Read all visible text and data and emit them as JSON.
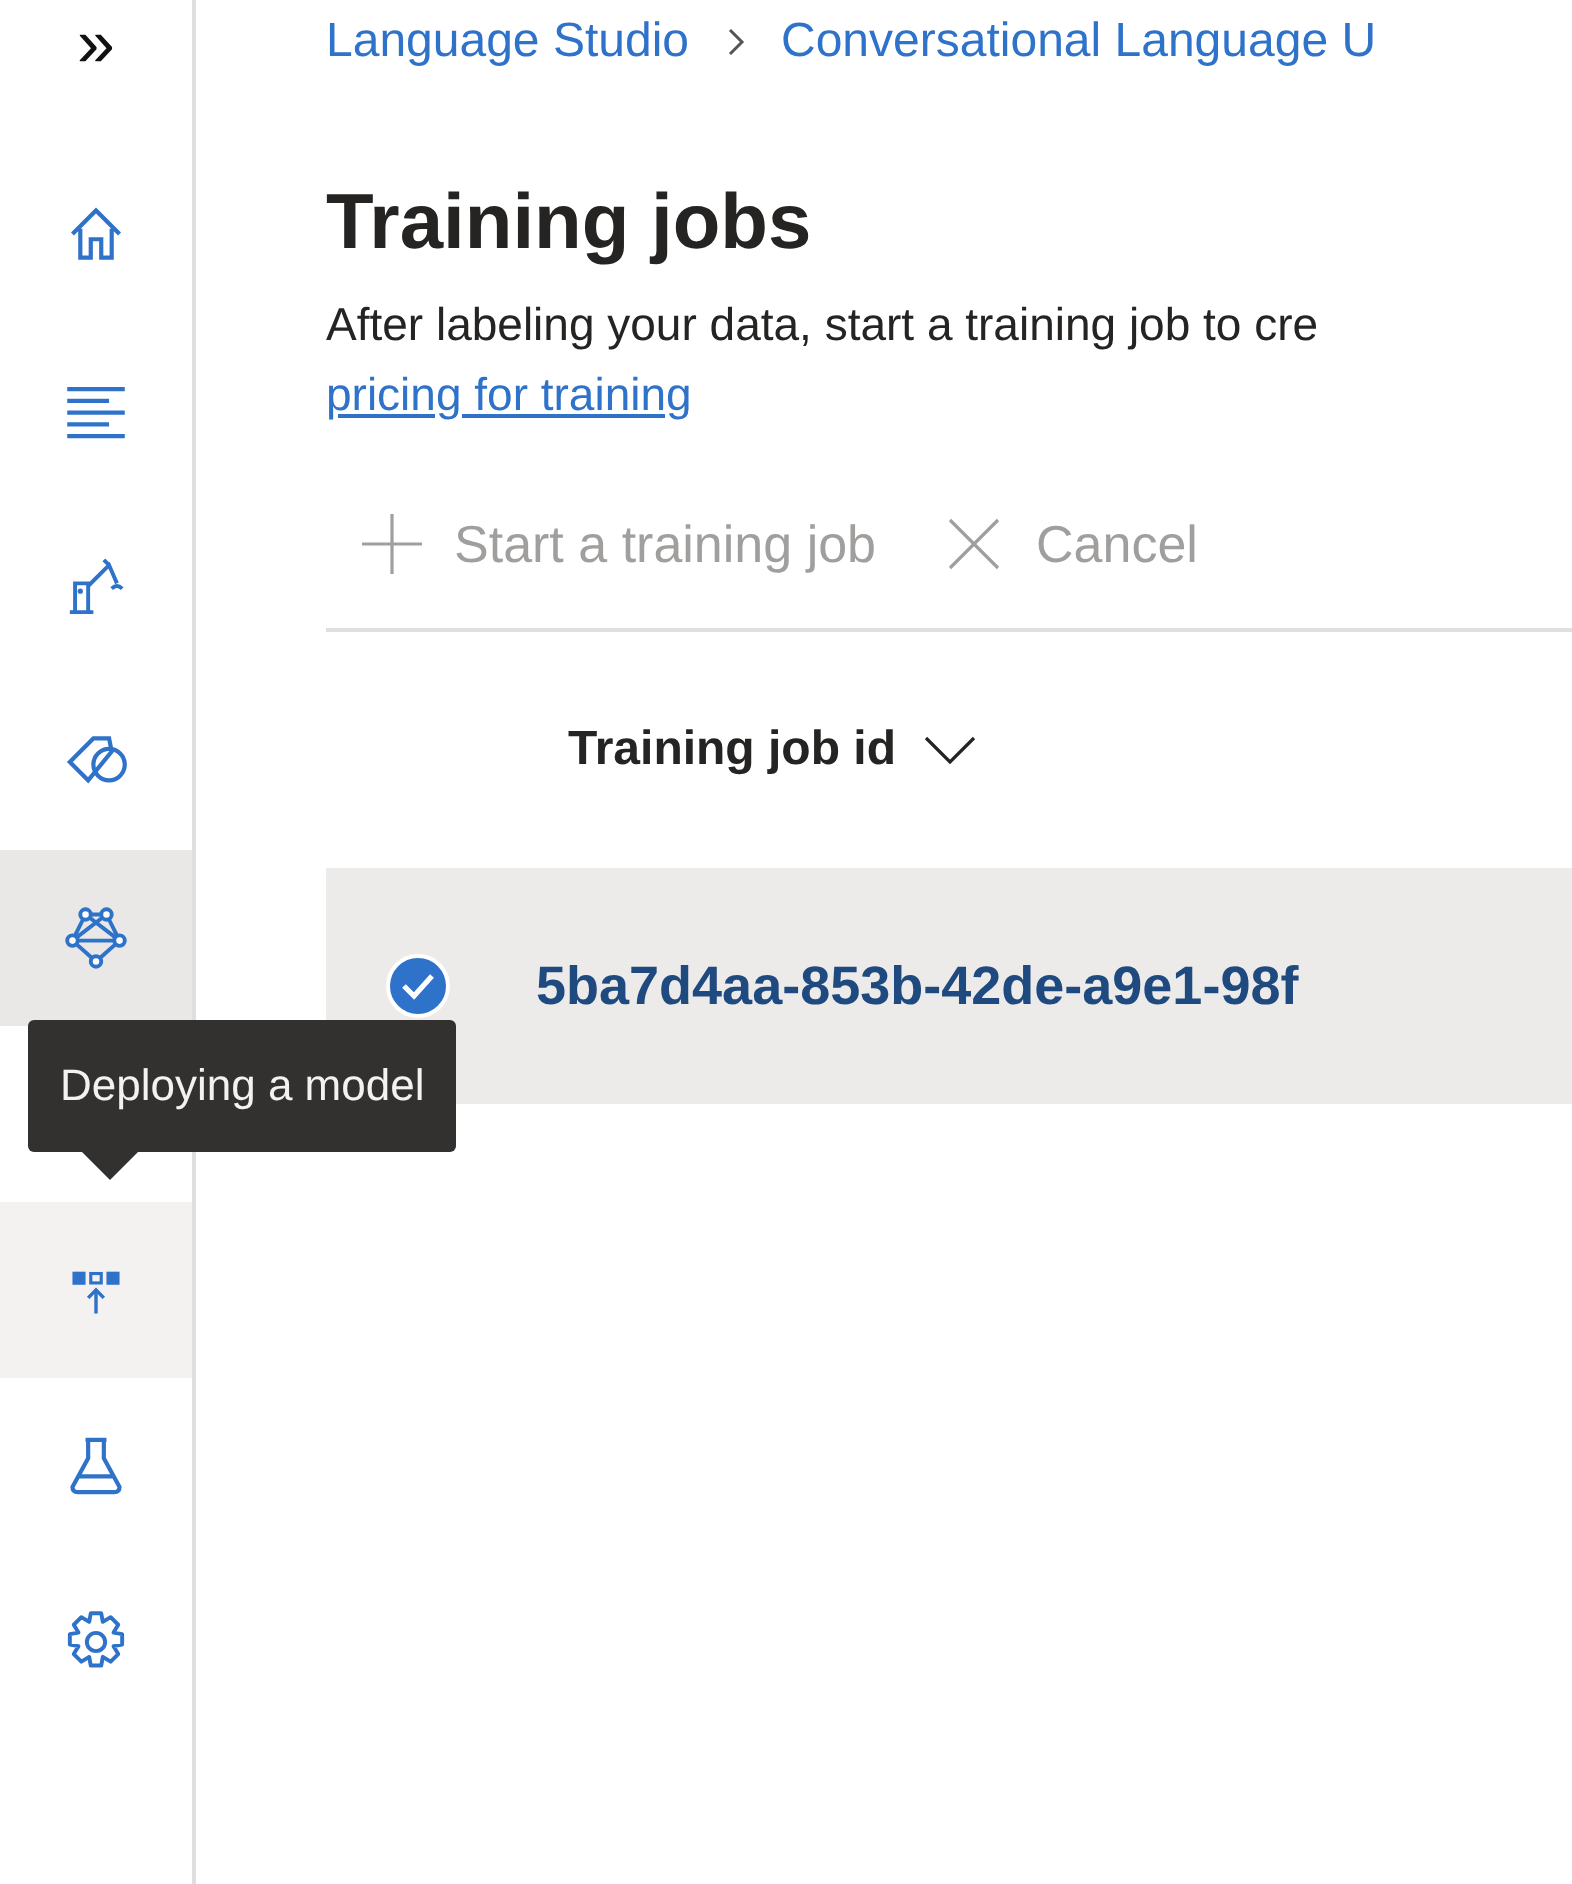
{
  "nav": {
    "expand_label": "»",
    "items": [
      {
        "kind": "home",
        "selected": false,
        "hovered": false
      },
      {
        "kind": "lines",
        "selected": false,
        "hovered": false
      },
      {
        "kind": "robot",
        "selected": false,
        "hovered": false
      },
      {
        "kind": "tag",
        "selected": false,
        "hovered": false
      },
      {
        "kind": "network",
        "selected": true,
        "hovered": false
      },
      {
        "kind": "deploy",
        "selected": false,
        "hovered": true
      },
      {
        "kind": "flask",
        "selected": false,
        "hovered": false
      },
      {
        "kind": "gear",
        "selected": false,
        "hovered": false
      }
    ]
  },
  "tooltip": {
    "text": "Deploying a model"
  },
  "breadcrumb": [
    "Language Studio",
    "Conversational Language U"
  ],
  "title": "Training jobs",
  "description": {
    "text": "After labeling your data, start a training job to cre",
    "link": "pricing for training"
  },
  "toolbar": [
    {
      "kind": "plus",
      "label": "Start a training job",
      "disabled": true
    },
    {
      "kind": "close",
      "label": "Cancel",
      "disabled": true
    }
  ],
  "table": {
    "columns": [
      "Training job id"
    ],
    "rows": [
      {
        "id": "5ba7d4aa-853b-42de-a9e1-98f",
        "selected": true
      }
    ]
  }
}
